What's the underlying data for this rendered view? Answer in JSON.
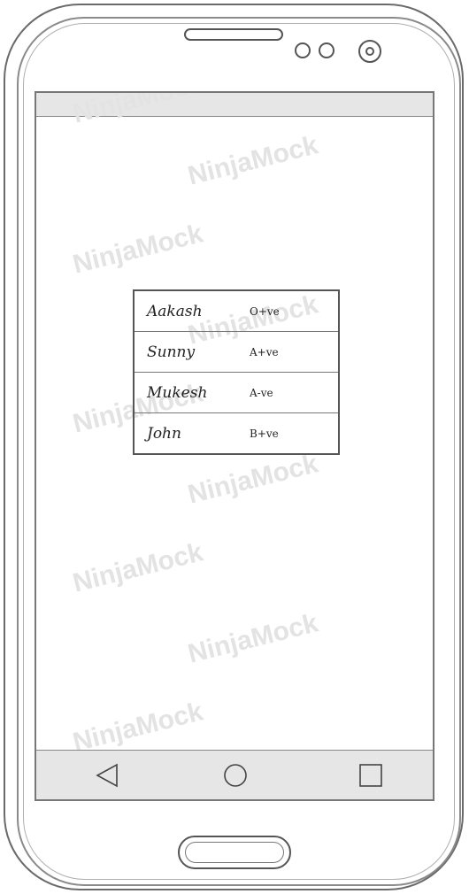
{
  "watermark": {
    "text": "NinjaMock"
  },
  "contacts": [
    {
      "name": "Aakash",
      "blood_group": "O+ve"
    },
    {
      "name": "Sunny",
      "blood_group": "A+ve"
    },
    {
      "name": "Mukesh",
      "blood_group": "A-ve"
    },
    {
      "name": "John",
      "blood_group": "B+ve"
    }
  ],
  "nav": {
    "back_icon": "back-triangle",
    "home_icon": "home-circle",
    "recent_icon": "recent-square"
  },
  "colors": {
    "bars": "#e6e6e6",
    "outline": "#555555",
    "watermark": "#e3e3e3"
  }
}
